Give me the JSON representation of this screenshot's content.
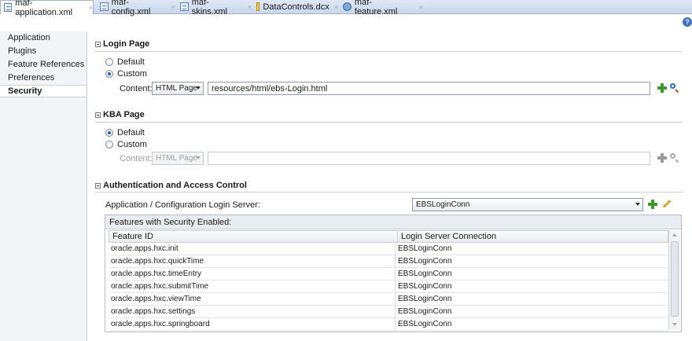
{
  "tabs": [
    {
      "label": "maf-application.xml",
      "icon": "xml-file-icon",
      "active": true
    },
    {
      "label": "maf-config.xml",
      "icon": "xml-file-icon",
      "active": false
    },
    {
      "label": "maf-skins.xml",
      "icon": "xml-file-icon",
      "active": false
    },
    {
      "label": "DataControls.dcx",
      "icon": "data-controls-icon",
      "active": false
    },
    {
      "label": "maf-feature.xml",
      "icon": "feature-file-icon",
      "active": false
    }
  ],
  "help_label": "?",
  "nav": {
    "items": [
      "Application",
      "Plugins",
      "Feature References",
      "Preferences",
      "Security"
    ],
    "selected": "Security"
  },
  "login_page": {
    "title": "Login Page",
    "default_label": "Default",
    "custom_label": "Custom",
    "selected": "Custom",
    "content_label": "Content:",
    "content_type": "HTML Page",
    "content_value": "resources/html/ebs-Login.html"
  },
  "kba_page": {
    "title": "KBA Page",
    "default_label": "Default",
    "custom_label": "Custom",
    "selected": "Default",
    "content_label": "Content:",
    "content_type": "HTML Page",
    "content_value": ""
  },
  "auth": {
    "title": "Authentication and Access Control",
    "server_label": "Application / Configuration Login Server:",
    "server_value": "EBSLoginConn",
    "table_caption": "Features with Security Enabled:",
    "columns": [
      "Feature ID",
      "Login Server Connection"
    ],
    "rows": [
      [
        "oracle.apps.hxc.init",
        "EBSLoginConn"
      ],
      [
        "oracle.apps.hxc.quickTime",
        "EBSLoginConn"
      ],
      [
        "oracle.apps.hxc.timeEntry",
        "EBSLoginConn"
      ],
      [
        "oracle.apps.hxc.submitTime",
        "EBSLoginConn"
      ],
      [
        "oracle.apps.hxc.viewTime",
        "EBSLoginConn"
      ],
      [
        "oracle.apps.hxc.settings",
        "EBSLoginConn"
      ],
      [
        "oracle.apps.hxc.springboard",
        "EBSLoginConn"
      ]
    ]
  },
  "colors": {
    "accent": "#2d5ea8",
    "add_green": "#3a9a2a",
    "tab_bar": "#c9d7ea"
  }
}
